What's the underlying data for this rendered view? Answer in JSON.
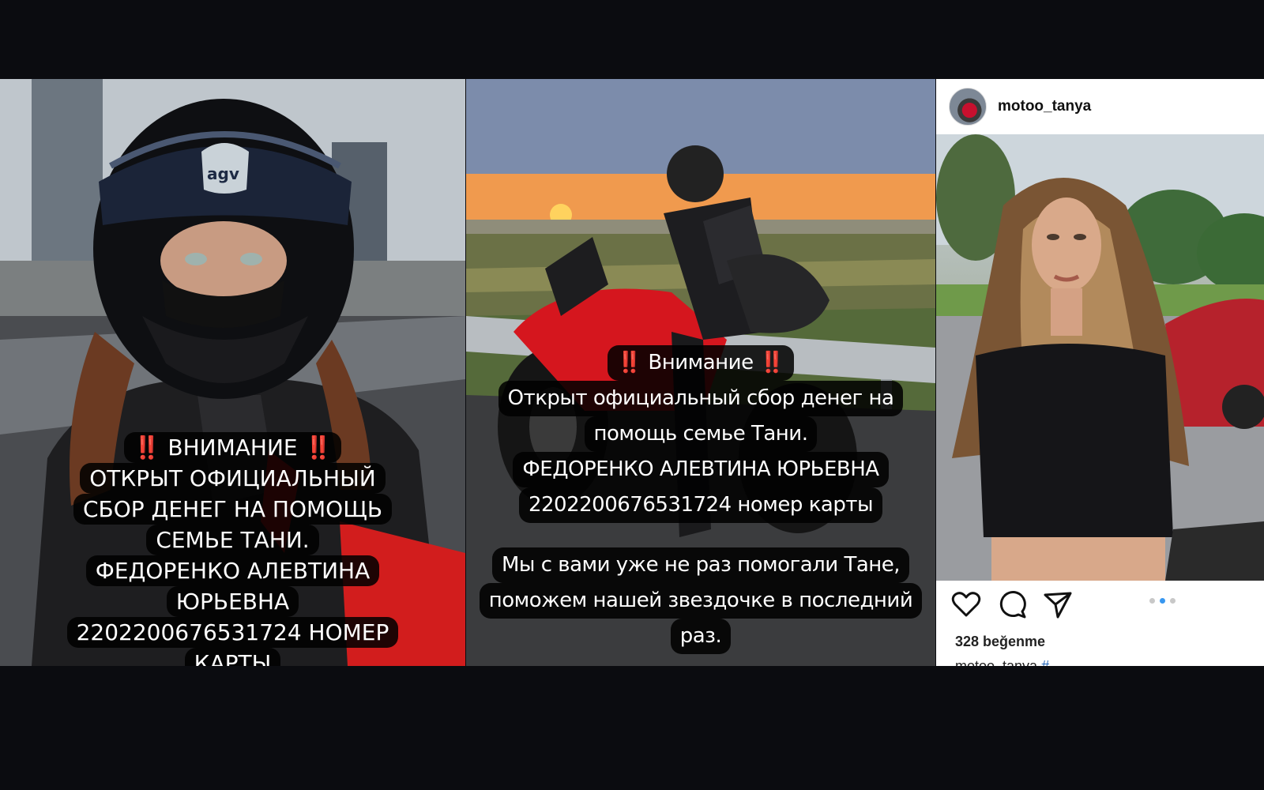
{
  "panels": {
    "left": {
      "lines": [
        "‼️ ВНИМАНИЕ ‼️",
        "ОТКРЫТ ОФИЦИАЛЬНЫЙ",
        "СБОР ДЕНЕГ НА ПОМОЩЬ",
        "СЕМЬЕ ТАНИ.",
        "ФЕДОРЕНКО АЛЕВТИНА",
        "ЮРЬЕВНА",
        "2202200676531724 НОМЕР",
        "КАРТЫ"
      ],
      "helmet_logo": "agv"
    },
    "middle": {
      "block1": [
        "‼️ Внимание ‼️",
        "Открыт официальный сбор денег на",
        "помощь семье Тани.",
        "ФЕДОРЕНКО АЛЕВТИНА ЮРЬЕВНА",
        "2202200676531724 номер карты"
      ],
      "block2": [
        "Мы с вами уже не раз помогали Тане,",
        "поможем нашей звездочке в последний",
        "раз."
      ]
    },
    "right": {
      "username": "motoo_tanya",
      "likes": "328 beğenme",
      "caption_user": "motoo_tanya",
      "caption_tag": "#"
    }
  },
  "icons": [
    "heart-icon",
    "comment-icon",
    "share-icon"
  ],
  "colors": {
    "accent": "#3897f0",
    "background": "#0b0c10",
    "bike_red": "#d5161e"
  }
}
